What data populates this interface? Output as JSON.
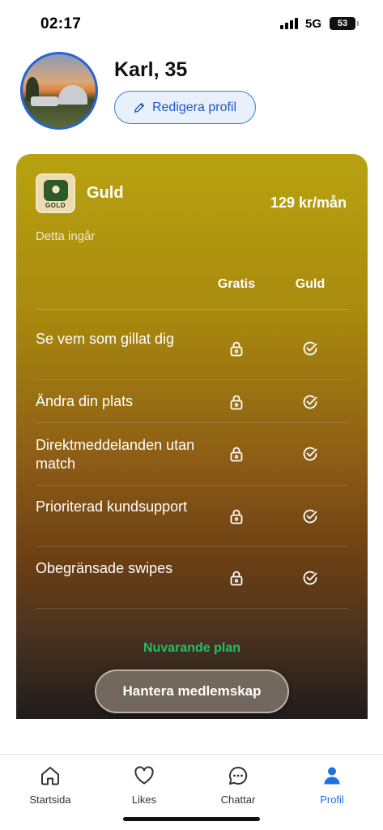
{
  "status_bar": {
    "time": "02:17",
    "network": "5G",
    "battery": "53"
  },
  "profile": {
    "name": "Karl, 35",
    "edit_label": "Redigera profil"
  },
  "plan": {
    "badge_text": "GOLD",
    "name": "Guld",
    "price": "129 kr/mån",
    "includes_label": "Detta ingår",
    "columns": {
      "free": "Gratis",
      "gold": "Guld"
    },
    "features": [
      {
        "label": "Se vem som gillat dig",
        "free": "locked",
        "gold": "included"
      },
      {
        "label": "Ändra din plats",
        "free": "locked",
        "gold": "included"
      },
      {
        "label": "Direktmeddelanden utan match",
        "free": "locked",
        "gold": "included"
      },
      {
        "label": "Prioriterad kundsupport",
        "free": "locked",
        "gold": "included"
      },
      {
        "label": "Obegränsade swipes",
        "free": "locked",
        "gold": "included"
      }
    ],
    "current_plan_label": "Nuvarande plan",
    "manage_label": "Hantera medlemskap"
  },
  "tabs": [
    {
      "label": "Startsida",
      "icon": "home-icon",
      "active": false
    },
    {
      "label": "Likes",
      "icon": "heart-icon",
      "active": false
    },
    {
      "label": "Chattar",
      "icon": "chat-bubble-icon",
      "active": false
    },
    {
      "label": "Profil",
      "icon": "person-icon",
      "active": true
    }
  ],
  "colors": {
    "accent": "#1f6fe5",
    "current_plan": "#21c064",
    "card_gradient_top": "#b8a210",
    "card_gradient_bottom": "#1f1c1b"
  }
}
